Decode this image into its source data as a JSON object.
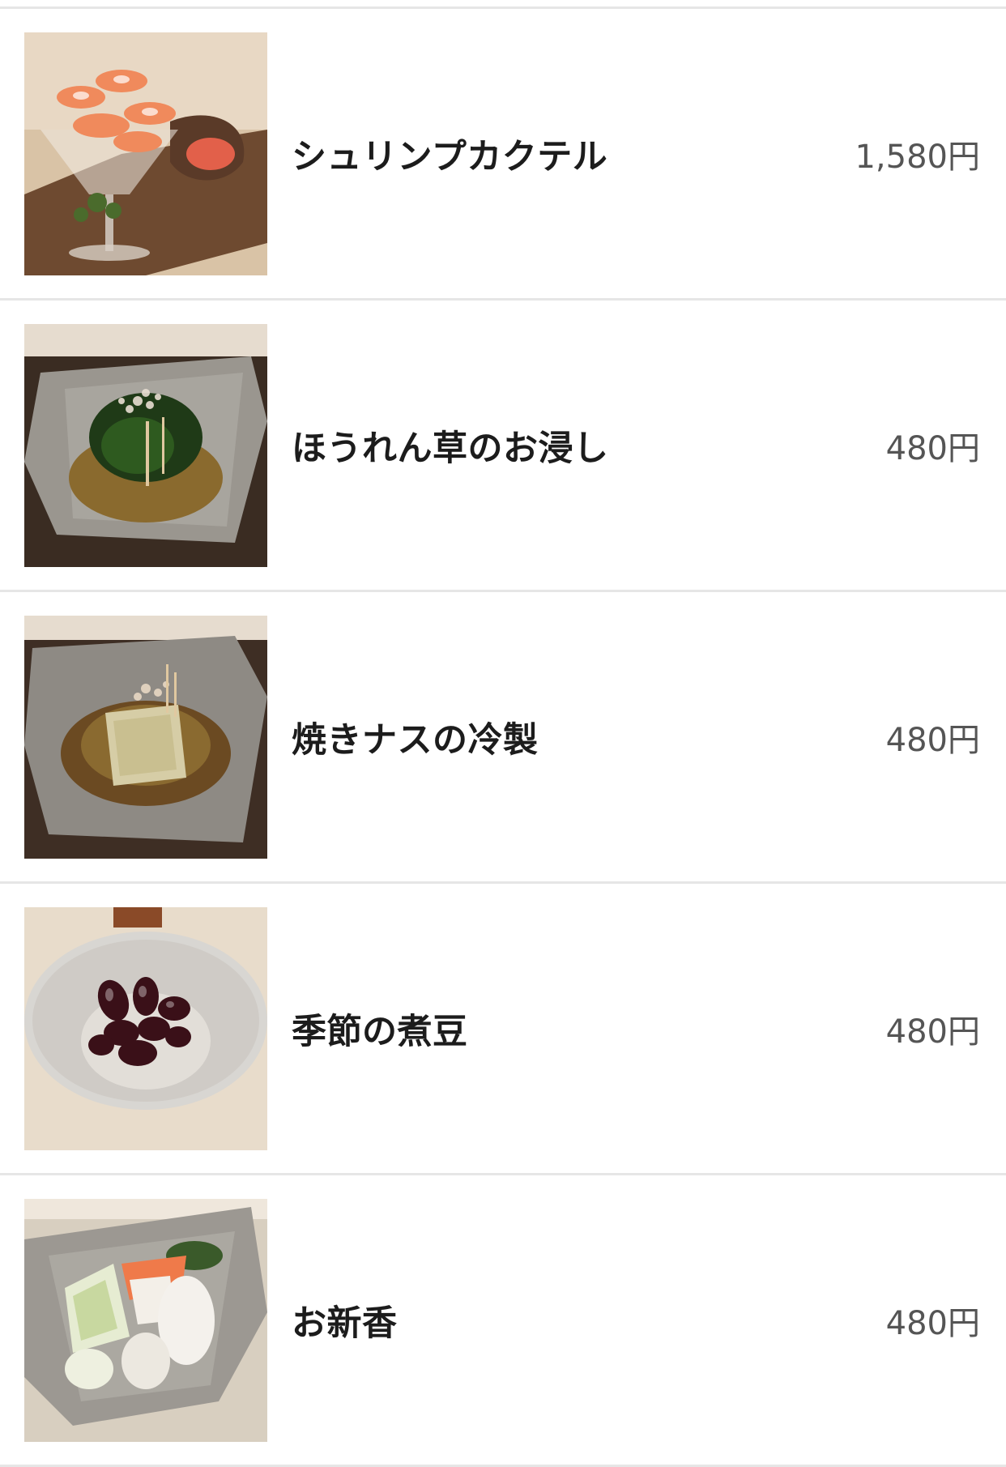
{
  "menu": {
    "items": [
      {
        "name": "シュリンプカクテル",
        "price": "1,580円",
        "image": "shrimp-cocktail-photo"
      },
      {
        "name": "ほうれん草のお浸し",
        "price": "480円",
        "image": "spinach-ohitashi-photo"
      },
      {
        "name": "焼きナスの冷製",
        "price": "480円",
        "image": "chilled-grilled-eggplant-photo"
      },
      {
        "name": "季節の煮豆",
        "price": "480円",
        "image": "seasonal-simmered-beans-photo"
      },
      {
        "name": "お新香",
        "price": "480円",
        "image": "oshinko-pickles-photo"
      }
    ]
  }
}
